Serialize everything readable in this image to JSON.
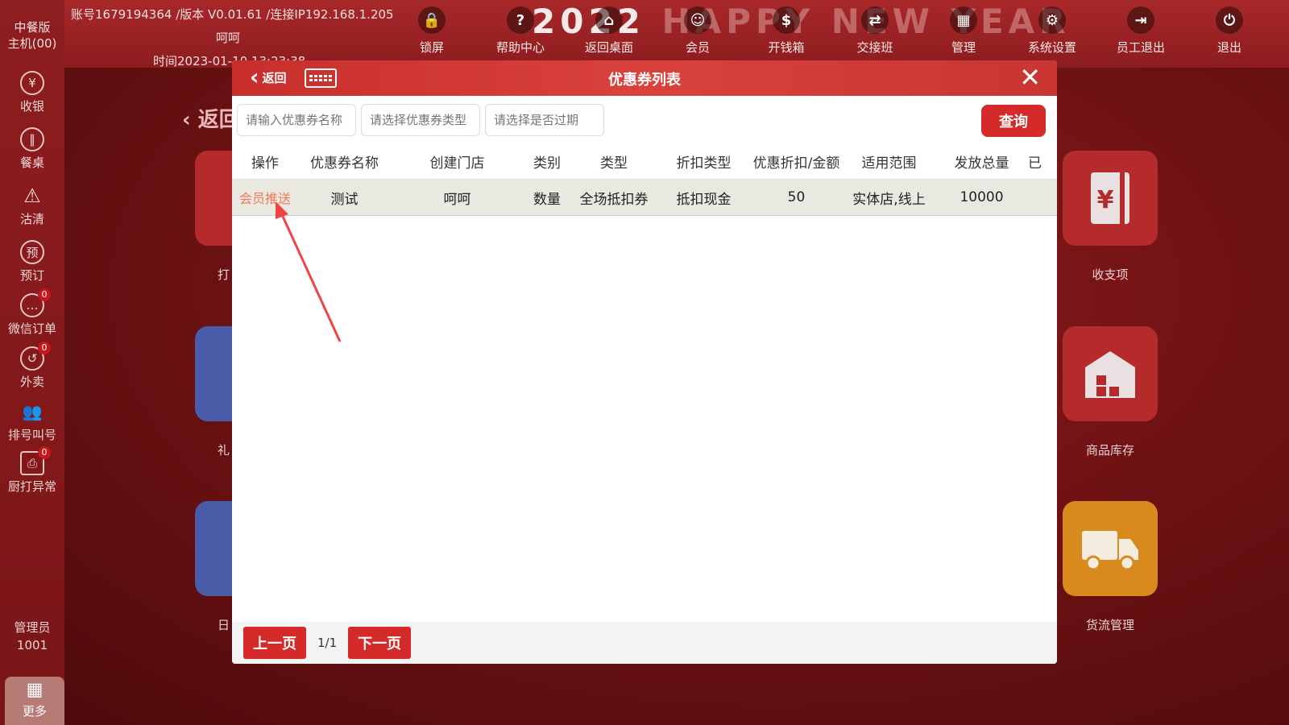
{
  "sidebar": {
    "brand_line1": "中餐版",
    "brand_line2": "主机(00)",
    "items": [
      {
        "label": "收银",
        "icon": "yen-icon"
      },
      {
        "label": "餐桌",
        "icon": "tableware-icon"
      },
      {
        "label": "沽清",
        "icon": "warning-icon"
      },
      {
        "label": "预订",
        "icon": "reserve-icon"
      },
      {
        "label": "微信订单",
        "icon": "wechat-icon",
        "badge": "0"
      },
      {
        "label": "外卖",
        "icon": "delivery-icon",
        "badge": "0"
      },
      {
        "label": "排号叫号",
        "icon": "queue-icon"
      },
      {
        "label": "厨打异常",
        "icon": "printer-icon",
        "badge": "0"
      }
    ],
    "admin_role": "管理员",
    "admin_id": "1001",
    "more_label": "更多"
  },
  "header": {
    "account_line": "账号1679194364 /版本 V0.01.61 /连接IP192.168.1.205",
    "store_name": "呵呵",
    "time_line": "时间2023-01-10 13:23:38",
    "banner_year": "2022",
    "banner_text": "HAPPY NEW YEAR",
    "nav": [
      {
        "label": "锁屏",
        "icon": "lock-icon"
      },
      {
        "label": "帮助中心",
        "icon": "help-icon"
      },
      {
        "label": "返回桌面",
        "icon": "home-icon"
      },
      {
        "label": "会员",
        "icon": "member-icon"
      },
      {
        "label": "开钱箱",
        "icon": "cashbox-icon"
      },
      {
        "label": "交接班",
        "icon": "shift-icon"
      },
      {
        "label": "管理",
        "icon": "manage-icon"
      },
      {
        "label": "系统设置",
        "icon": "settings-icon"
      },
      {
        "label": "员工退出",
        "icon": "logout-icon"
      },
      {
        "label": "退出",
        "icon": "power-icon"
      }
    ]
  },
  "background": {
    "back_label": "返回",
    "tiles_right": [
      {
        "label": "收支项",
        "color": "#b52a2a"
      },
      {
        "label": "商品库存",
        "color": "#b52a2a"
      },
      {
        "label": "货流管理",
        "color": "#d98a1c"
      }
    ],
    "tiles_left_partial": [
      {
        "label": "打",
        "color": "#b52a2a"
      },
      {
        "label": "礼",
        "color": "#4a5ca8"
      },
      {
        "label": "日",
        "color": "#4a5ca8"
      }
    ]
  },
  "modal": {
    "back_label": "返回",
    "title": "优惠券列表",
    "filters": {
      "name_placeholder": "请输入优惠券名称",
      "type_placeholder": "请选择优惠券类型",
      "expired_placeholder": "请选择是否过期"
    },
    "query_label": "查询",
    "columns": [
      "操作",
      "优惠券名称",
      "创建门店",
      "类别",
      "类型",
      "折扣类型",
      "优惠折扣/金额",
      "适用范围",
      "发放总量",
      "已"
    ],
    "rows": [
      {
        "action": "会员推送",
        "name": "测试",
        "store": "呵呵",
        "category": "数量",
        "type": "全场抵扣券",
        "discount_type": "抵扣现金",
        "amount": "50",
        "scope": "实体店,线上",
        "total": "10000",
        "extra": ""
      }
    ],
    "pager": {
      "prev": "上一页",
      "info": "1/1",
      "next": "下一页"
    }
  }
}
